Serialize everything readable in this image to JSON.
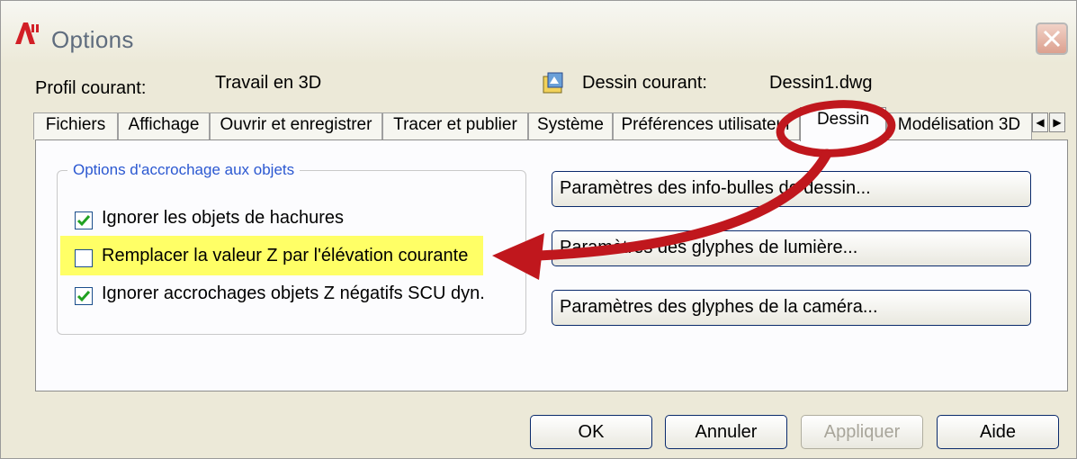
{
  "window": {
    "title": "Options"
  },
  "profile": {
    "label": "Profil courant:",
    "value": "Travail en 3D"
  },
  "drawing": {
    "label": "Dessin courant:",
    "value": "Dessin1.dwg"
  },
  "tabs": [
    {
      "label": "Fichiers"
    },
    {
      "label": "Affichage"
    },
    {
      "label": "Ouvrir et enregistrer"
    },
    {
      "label": "Tracer et publier"
    },
    {
      "label": "Système"
    },
    {
      "label": "Préférences utilisateur"
    },
    {
      "label": "Dessin"
    },
    {
      "label": "Modélisation 3D"
    }
  ],
  "active_tab": "Dessin",
  "group": {
    "title": "Options d'accrochage aux objets",
    "options": [
      {
        "label": "Ignorer les objets de hachures",
        "checked": true
      },
      {
        "label": "Remplacer la valeur Z par l'élévation courante",
        "checked": false
      },
      {
        "label": "Ignorer accrochages objets Z négatifs SCU dyn.",
        "checked": true
      }
    ]
  },
  "settings_buttons": [
    {
      "label": "Paramètres des info-bulles de dessin..."
    },
    {
      "label": "Paramètres des glyphes de lumière..."
    },
    {
      "label": "Paramètres des glyphes de la caméra..."
    }
  ],
  "footer": {
    "ok": "OK",
    "cancel": "Annuler",
    "apply": "Appliquer",
    "help": "Aide"
  },
  "colors": {
    "annotation": "#c0171d",
    "highlight": "#ffff66",
    "group_title": "#2b58d1"
  }
}
